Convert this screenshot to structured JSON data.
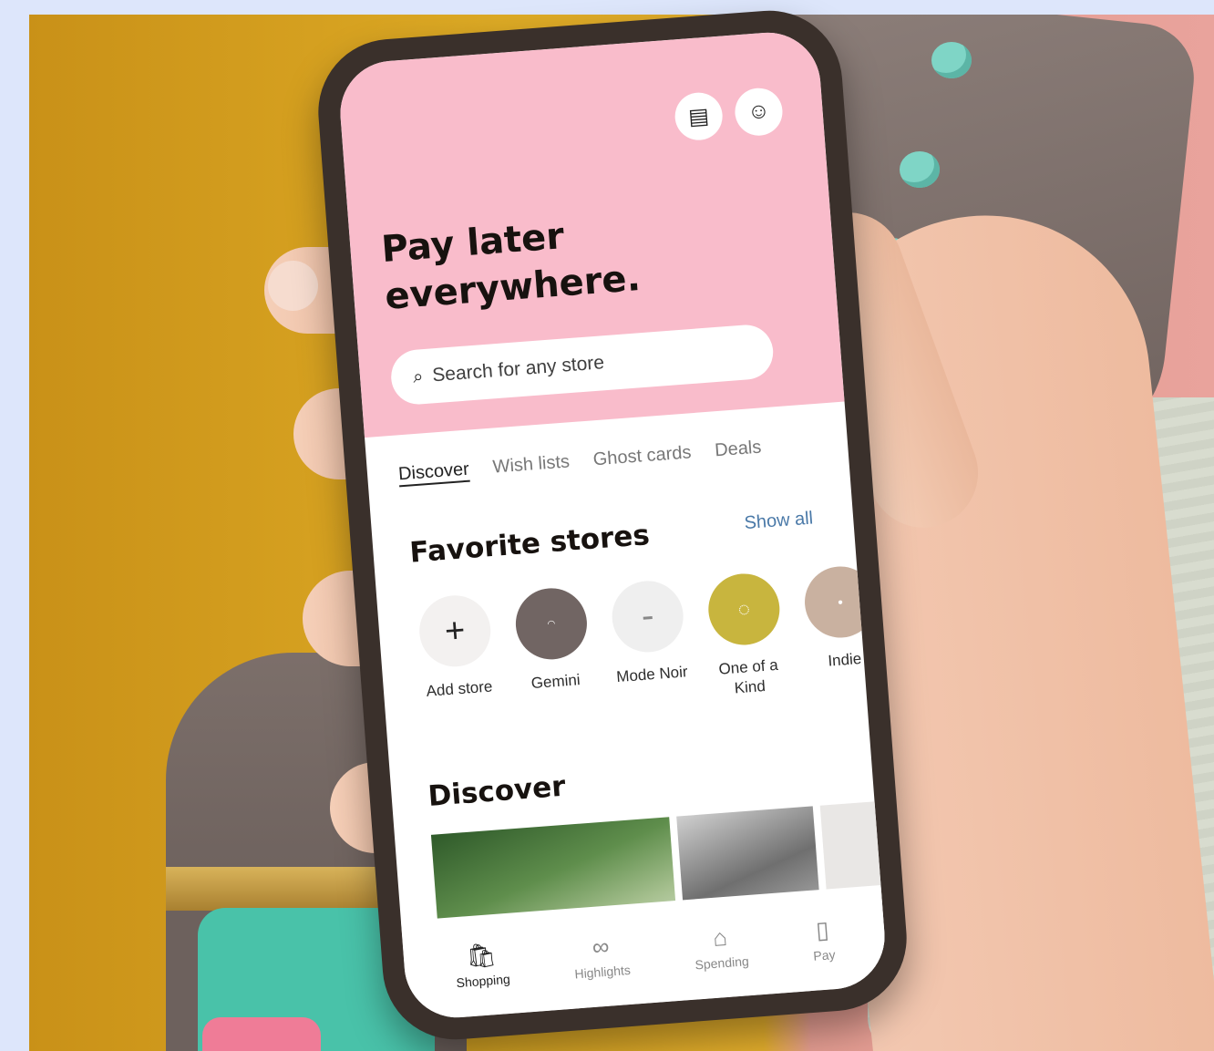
{
  "app": {
    "header": {
      "receipt_icon": "receipt-icon",
      "profile_icon": "smiley-face-icon",
      "headline_line1": "Pay later",
      "headline_line2": "everywhere."
    },
    "search": {
      "placeholder": "Search for any store",
      "icon": "search-icon"
    },
    "tabs": [
      {
        "label": "Discover",
        "active": true
      },
      {
        "label": "Wish lists",
        "active": false
      },
      {
        "label": "Ghost cards",
        "active": false
      },
      {
        "label": "Deals",
        "active": false
      }
    ],
    "favorite_stores": {
      "title": "Favorite stores",
      "show_all": "Show all",
      "items": [
        {
          "label": "Add store",
          "icon": "plus-icon",
          "color": "#f3f1f0"
        },
        {
          "label": "Gemini",
          "color": "#716563"
        },
        {
          "label": "Mode Noir",
          "color": "#efefef"
        },
        {
          "label": "One of a\nKind",
          "color": "#c8b53e"
        },
        {
          "label": "Indie",
          "color": "#c9b1a0"
        }
      ]
    },
    "discover": {
      "title": "Discover"
    },
    "bottom_nav": [
      {
        "label": "Shopping",
        "icon": "shopping-bag-icon",
        "active": true
      },
      {
        "label": "Highlights",
        "icon": "glasses-icon",
        "active": false
      },
      {
        "label": "Spending",
        "icon": "spending-box-icon",
        "active": false
      },
      {
        "label": "Pay",
        "icon": "receipt-icon",
        "active": false
      }
    ]
  },
  "colors": {
    "header_pink": "#f9bccb",
    "background": "#dde6fb",
    "wall_yellow": "#ddaa25",
    "wall_pink": "#e9a39c",
    "link_blue": "#4a79a8"
  }
}
